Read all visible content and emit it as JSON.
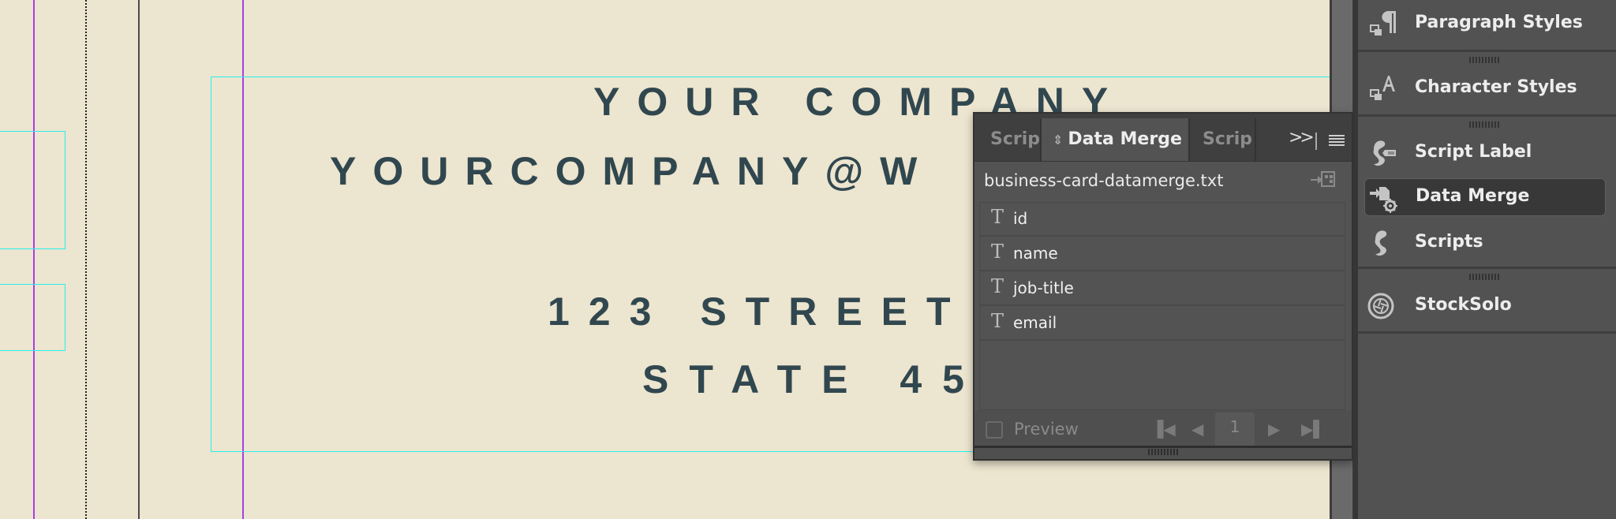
{
  "canvas": {
    "card_lines": [
      "YOUR COMPANY",
      "YOURCOMPANY@W",
      "123 STREET",
      "STATE 45"
    ]
  },
  "panel": {
    "tabs": [
      {
        "label": "Scrip",
        "active": false
      },
      {
        "label": "Data Merge",
        "active": true
      },
      {
        "label": "Scrip",
        "active": false
      }
    ],
    "overflow_icon": "double-chevron-right-icon",
    "menu_icon": "hamburger-menu-icon",
    "source_file": "business-card-datamerge.txt",
    "fields": [
      {
        "icon": "text-field-icon",
        "label": "id"
      },
      {
        "icon": "text-field-icon",
        "label": "name"
      },
      {
        "icon": "text-field-icon",
        "label": "job-title"
      },
      {
        "icon": "text-field-icon",
        "label": "email"
      }
    ],
    "footer": {
      "preview_label": "Preview",
      "preview_checked": false,
      "record_number": "1"
    }
  },
  "dock": {
    "items": [
      {
        "label": "Paragraph Styles",
        "icon": "paragraph-styles-icon",
        "active": false
      },
      {
        "label": "Character Styles",
        "icon": "character-styles-icon",
        "active": false
      },
      {
        "label": "Script Label",
        "icon": "script-label-icon",
        "active": false
      },
      {
        "label": "Data Merge",
        "icon": "data-merge-icon",
        "active": true
      },
      {
        "label": "Scripts",
        "icon": "scripts-icon",
        "active": false
      },
      {
        "label": "StockSolo",
        "icon": "stocksolo-icon",
        "active": false
      }
    ]
  }
}
